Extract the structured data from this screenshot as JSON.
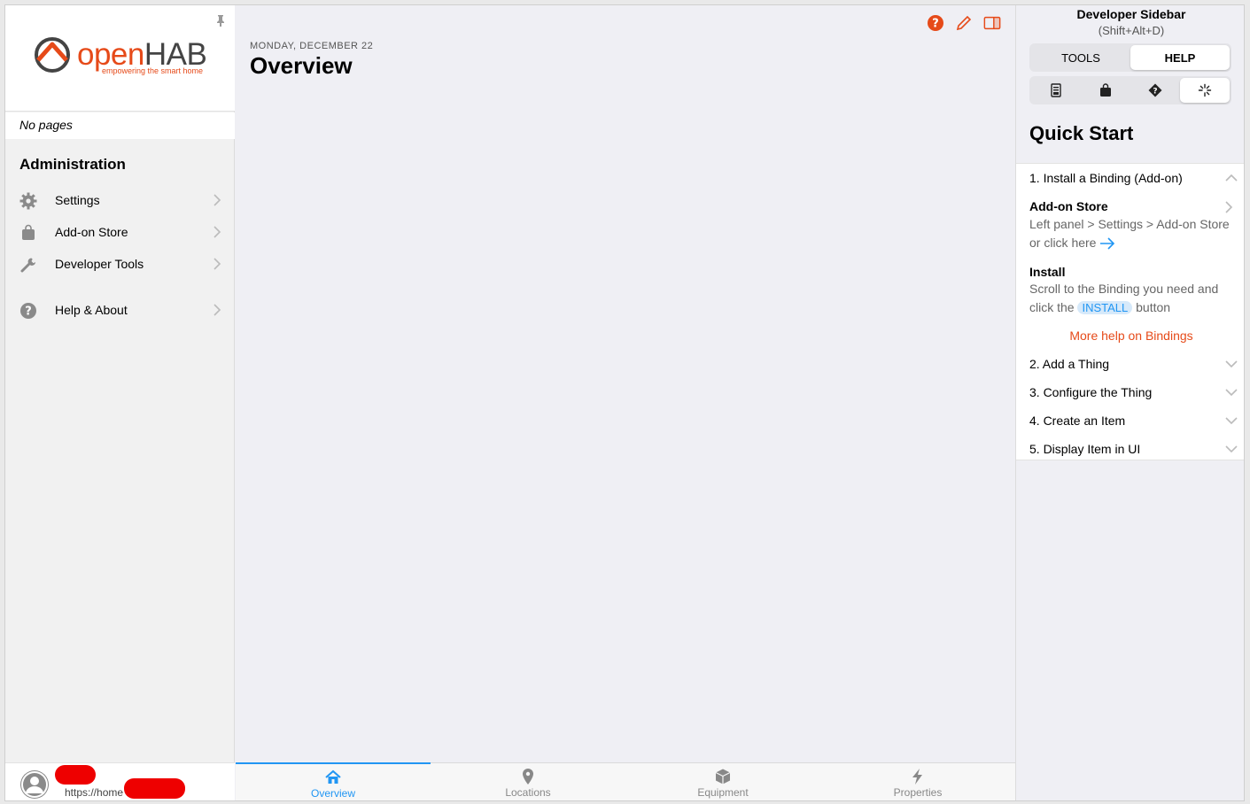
{
  "left_panel": {
    "logo": {
      "word_a": "open",
      "word_b": "HAB",
      "tagline": "empowering the smart home"
    },
    "no_pages": "No pages",
    "section_title": "Administration",
    "items": [
      {
        "label": "Settings",
        "icon": "gear-icon"
      },
      {
        "label": "Add-on Store",
        "icon": "shopping-bag-icon"
      },
      {
        "label": "Developer Tools",
        "icon": "wrench-icon"
      },
      {
        "label": "Help & About",
        "icon": "help-circle-icon"
      }
    ],
    "user": {
      "url": "https://home"
    }
  },
  "main": {
    "date": "MONDAY, DECEMBER 22",
    "title": "Overview",
    "tabs": [
      {
        "label": "Overview",
        "icon": "house-icon",
        "active": true
      },
      {
        "label": "Locations",
        "icon": "map-pin-icon",
        "active": false
      },
      {
        "label": "Equipment",
        "icon": "cube-icon",
        "active": false
      },
      {
        "label": "Properties",
        "icon": "bolt-icon",
        "active": false
      }
    ],
    "accent_color": "#2196f3",
    "brand_color": "#e64a19"
  },
  "right_panel": {
    "title": "Developer Sidebar",
    "shortcut": "(Shift+Alt+D)",
    "mode_tabs": [
      "TOOLS",
      "HELP"
    ],
    "active_mode": "HELP",
    "help_tabs": [
      "document-icon",
      "shopping-bag-icon",
      "diamond-question-icon",
      "sparkle-icon"
    ],
    "quick_start": {
      "title": "Quick Start",
      "steps": [
        "1. Install a Binding (Add-on)",
        "2. Add a Thing",
        "3. Configure the Thing",
        "4. Create an Item",
        "5. Display Item in UI"
      ],
      "addon_store_heading": "Add-on Store",
      "addon_store_text": "Left panel > Settings > Add-on Store",
      "or_click_here": "or click here",
      "install_heading": "Install",
      "install_text_a": "Scroll to the Binding you need and",
      "install_text_b": "click the",
      "install_pill": "INSTALL",
      "install_text_c": "button",
      "more_help": "More help on Bindings"
    }
  }
}
